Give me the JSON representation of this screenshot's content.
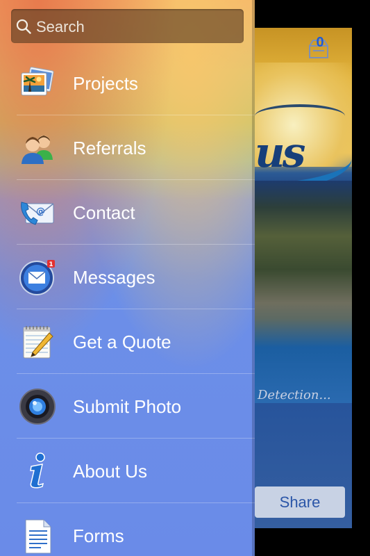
{
  "search": {
    "placeholder": "Search"
  },
  "menu": {
    "items": [
      {
        "label": "Projects",
        "icon": "photos-icon"
      },
      {
        "label": "Referrals",
        "icon": "people-icon"
      },
      {
        "label": "Contact",
        "icon": "contact-phone-email-icon"
      },
      {
        "label": "Messages",
        "icon": "mail-badge-icon",
        "badge": "1"
      },
      {
        "label": "Get a Quote",
        "icon": "notepad-pencil-icon"
      },
      {
        "label": "Submit Photo",
        "icon": "camera-lens-icon"
      },
      {
        "label": "About Us",
        "icon": "info-icon"
      },
      {
        "label": "Forms",
        "icon": "document-icon"
      }
    ]
  },
  "background": {
    "cart_count": "0",
    "logo_text": "us",
    "tagline": "Detection...",
    "share_label": "Share"
  },
  "colors": {
    "accent": "#1d5bd8",
    "drawer_top": "#f5b16a",
    "drawer_bottom": "#6a8be8"
  }
}
